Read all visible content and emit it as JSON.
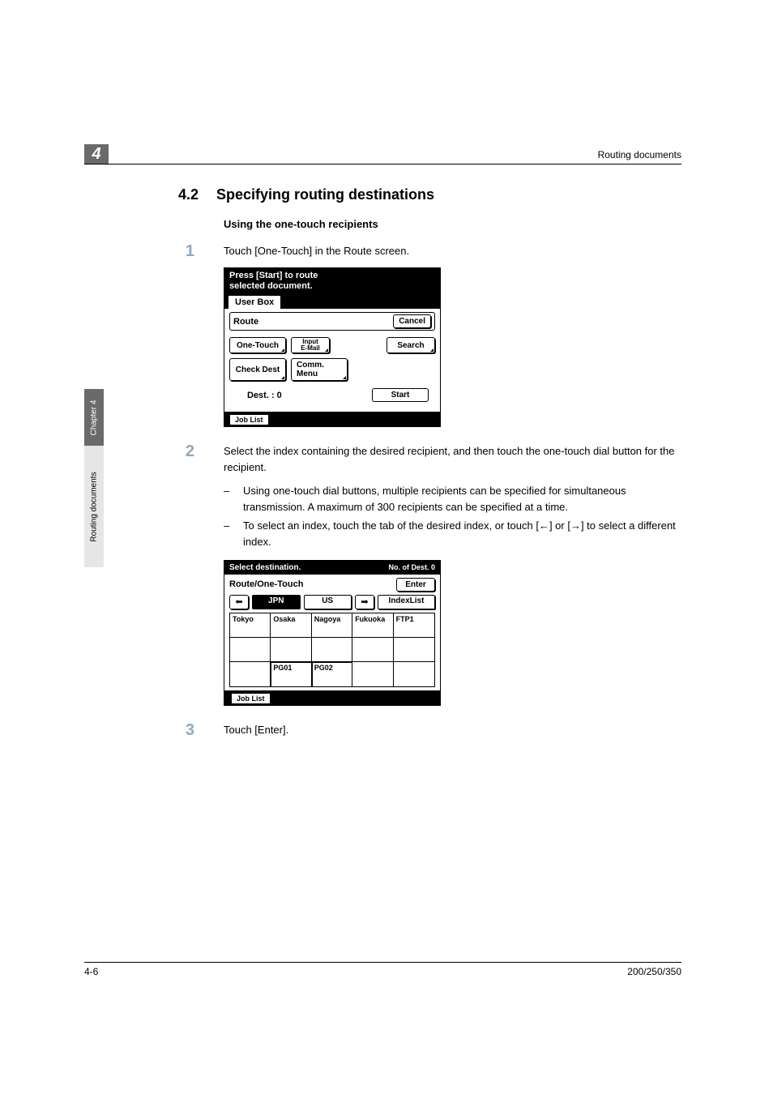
{
  "chapter_badge": "4",
  "header_right": "Routing documents",
  "side": {
    "dark": "Chapter 4",
    "light": "Routing documents"
  },
  "section": {
    "num": "4.2",
    "title": "Specifying routing destinations",
    "subhead": "Using the one-touch recipients"
  },
  "steps": {
    "s1": {
      "num": "1",
      "text": "Touch [One-Touch] in the Route screen."
    },
    "s2": {
      "num": "2",
      "text": "Select the index containing the desired recipient, and then touch the one-touch dial button for the recipient.",
      "b1": "Using one-touch dial buttons, multiple recipients can be specified for simultaneous transmission. A maximum of 300 recipients can be specified at a time.",
      "b2": "To select an index, touch the tab of the desired index, or touch [←] or [→] to select a different index."
    },
    "s3": {
      "num": "3",
      "text": "Touch [Enter]."
    }
  },
  "screen1": {
    "title_line1": "Press [Start] to route",
    "title_line2": "selected document.",
    "tab": "User Box",
    "route_label": "Route",
    "cancel": "Cancel",
    "onetouch": "One-Touch",
    "input1": "Input",
    "input2": "E-Mail",
    "search": "Search",
    "checkdest": "Check Dest",
    "commmenu": "Comm. Menu",
    "dest": "Dest.  :   0",
    "start": "Start",
    "joblist": "Job List"
  },
  "screen2": {
    "top_left": "Select destination.",
    "top_right": "No. of Dest.  0",
    "head": "Route/One-Touch",
    "enter": "Enter",
    "left_arrow": "⬅",
    "right_arrow": "➡",
    "tab_jpn": "JPN",
    "tab_us": "US",
    "tab_index": "IndexList",
    "cells": {
      "r0c0": "Tokyo",
      "r0c1": "Osaka",
      "r0c2": "Nagoya",
      "r0c3": "Fukuoka",
      "r0c4": "FTP1",
      "r1c0": "",
      "r1c1": "",
      "r1c2": "",
      "r1c3": "",
      "r1c4": "",
      "r2c0": "",
      "r2c1": "PG01",
      "r2c2": "PG02",
      "r2c3": "",
      "r2c4": ""
    },
    "joblist": "Job List"
  },
  "footer": {
    "left": "4-6",
    "right": "200/250/350"
  }
}
